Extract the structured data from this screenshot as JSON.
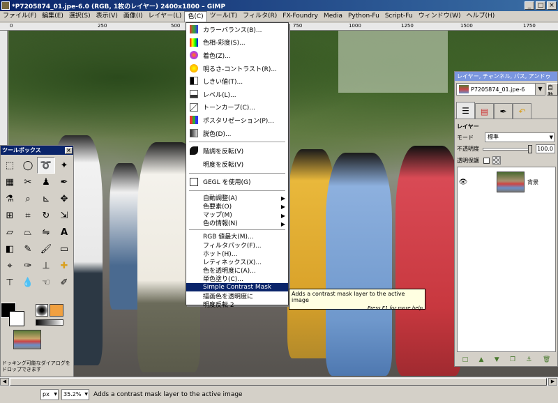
{
  "window": {
    "title": "*P7205874_01.jpe-6.0 (RGB, 1枚のレイヤー) 2400x1800 – GIMP",
    "min": "_",
    "max": "□",
    "close": "×"
  },
  "menubar": [
    "ファイル(F)",
    "編集(E)",
    "選択(S)",
    "表示(V)",
    "画像(I)",
    "レイヤー(L)",
    "色(C)",
    "ツール(T)",
    "フィルタ(R)",
    "FX-Foundry",
    "Media",
    "Python-Fu",
    "Script-Fu",
    "ウィンドウ(W)",
    "ヘルプ(H)"
  ],
  "ruler": [
    "0",
    "250",
    "500",
    "750",
    "1000",
    "1250",
    "1500",
    "1750"
  ],
  "color_menu": {
    "group1": [
      "カラーバランス(B)...",
      "色相-彩度(S)...",
      "着色(Z)...",
      "明るさ-コントラスト(R)...",
      "しきい値(T)...",
      "レベル(L)...",
      "トーンカーブ(C)...",
      "ポスタリゼーション(P)...",
      "脱色(D)..."
    ],
    "group2": [
      "階調を反転(V)",
      "明度を反転(V)"
    ],
    "group3": [
      "GEGL を使用(G)"
    ],
    "group4": [
      "自動調整(A)",
      "色要素(O)",
      "マップ(M)",
      "色の情報(N)"
    ],
    "group5": [
      "RGB 値最大(M)...",
      "フィルタパック(F)...",
      "ホット(H)...",
      "レティネックス(X)...",
      "色を透明度に(A)...",
      "単色塗り(C)...",
      "Simple Contrast Mask",
      "描画色を透明度に",
      "明度反転 2"
    ]
  },
  "tooltip": {
    "text": "Adds a contrast mask layer to the active image",
    "hint": "Press F1 for more help"
  },
  "toolbox": {
    "title": "ツールボックス",
    "close": "×",
    "drop_hint": "ドッキング可能なダイアログをドロップできます"
  },
  "layers": {
    "title": "レイヤー, チャンネル, パス, アンドゥ",
    "image": "P7205874_01.jpe-6",
    "auto_button": "自動",
    "section": "レイヤー",
    "mode_label": "モード",
    "mode_value": "標準",
    "opacity_label": "不透明度",
    "opacity_value": "100.0",
    "opacity": 1.0,
    "lock_label": "透明保護",
    "layer_name": "背景"
  },
  "status": {
    "unit": "px",
    "zoom": "35.2%",
    "message": "Adds a contrast mask layer to the active image"
  }
}
